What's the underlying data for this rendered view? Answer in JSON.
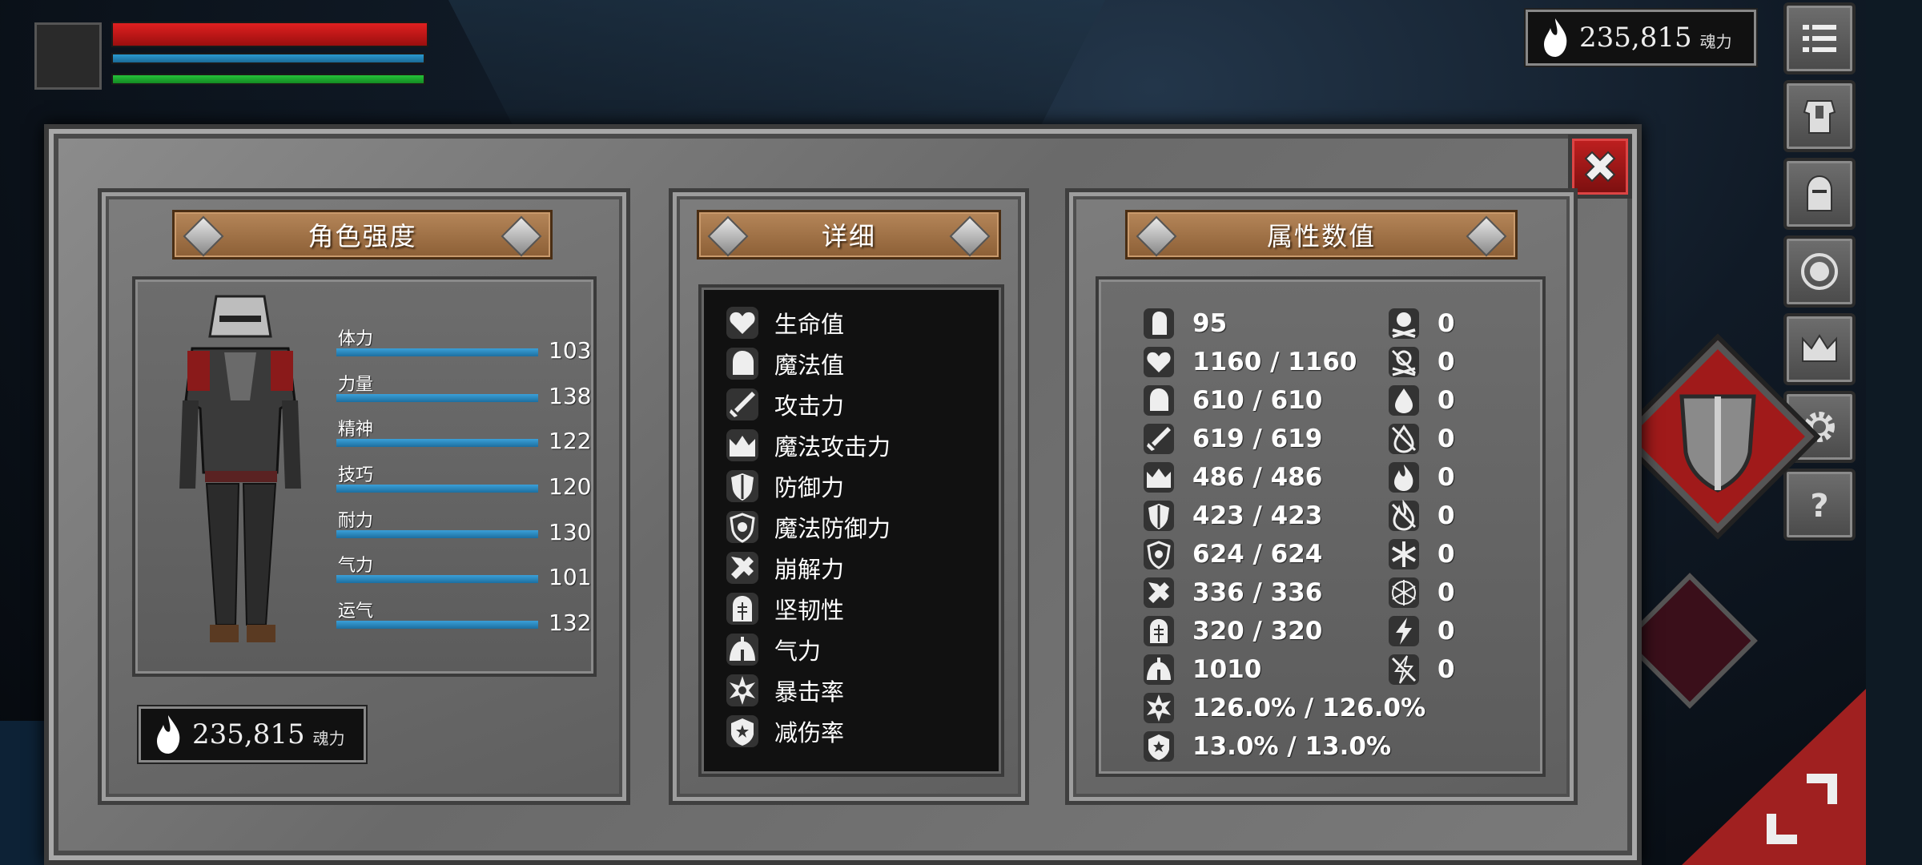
{
  "hud": {
    "hp_fill": 1.0,
    "mp_fill": 1.0,
    "stamina_fill": 1.0
  },
  "souls": {
    "amount": "235,815",
    "unit": "魂力"
  },
  "panels": {
    "left_title": "角色强度",
    "mid_title": "详细",
    "right_title": "属性数值"
  },
  "character_stats": [
    {
      "label": "体力",
      "value": "103"
    },
    {
      "label": "力量",
      "value": "138"
    },
    {
      "label": "精神",
      "value": "122"
    },
    {
      "label": "技巧",
      "value": "120"
    },
    {
      "label": "耐力",
      "value": "130"
    },
    {
      "label": "气力",
      "value": "101"
    },
    {
      "label": "运气",
      "value": "132"
    }
  ],
  "details": [
    {
      "icon": "heart-icon",
      "label": "生命值"
    },
    {
      "icon": "head-icon",
      "label": "魔法值"
    },
    {
      "icon": "sword-icon",
      "label": "攻击力"
    },
    {
      "icon": "magic-attack-icon",
      "label": "魔法攻击力"
    },
    {
      "icon": "shield-icon",
      "label": "防御力"
    },
    {
      "icon": "magic-shield-icon",
      "label": "魔法防御力"
    },
    {
      "icon": "break-icon",
      "label": "崩解力"
    },
    {
      "icon": "helmet-icon",
      "label": "坚韧性"
    },
    {
      "icon": "lungs-icon",
      "label": "气力"
    },
    {
      "icon": "critical-icon",
      "label": "暴击率"
    },
    {
      "icon": "damage-reduction-icon",
      "label": "减伤率"
    }
  ],
  "attributes_left": [
    {
      "icon": "armor-icon",
      "value": "95"
    },
    {
      "icon": "heart-icon",
      "value": "1160 / 1160"
    },
    {
      "icon": "head-icon",
      "value": "610 / 610"
    },
    {
      "icon": "sword-icon",
      "value": "619 / 619"
    },
    {
      "icon": "magic-attack-icon",
      "value": "486 / 486"
    },
    {
      "icon": "shield-icon",
      "value": "423 / 423"
    },
    {
      "icon": "magic-shield-icon",
      "value": "624 / 624"
    },
    {
      "icon": "break-icon",
      "value": "336 / 336"
    },
    {
      "icon": "helmet-icon",
      "value": "320 / 320"
    },
    {
      "icon": "lungs-icon",
      "value": "1010"
    },
    {
      "icon": "critical-icon",
      "value": "126.0% / 126.0%"
    },
    {
      "icon": "damage-reduction-icon",
      "value": "13.0% / 13.0%"
    }
  ],
  "attributes_right": [
    {
      "icon": "poison-skull-icon",
      "value": "0"
    },
    {
      "icon": "poison-resist-icon",
      "value": "0"
    },
    {
      "icon": "bleed-icon",
      "value": "0"
    },
    {
      "icon": "bleed-resist-icon",
      "value": "0"
    },
    {
      "icon": "fire-icon",
      "value": "0"
    },
    {
      "icon": "fire-resist-icon",
      "value": "0"
    },
    {
      "icon": "frost-icon",
      "value": "0"
    },
    {
      "icon": "frost-resist-icon",
      "value": "0"
    },
    {
      "icon": "lightning-icon",
      "value": "0"
    },
    {
      "icon": "lightning-resist-icon",
      "value": "0"
    }
  ],
  "side_menu": [
    "menu-icon",
    "armor-icon",
    "helmet-icon",
    "emblem-icon",
    "crown-icon",
    "gear-icon",
    "help-icon"
  ],
  "colors": {
    "hp": "#e02020",
    "mp": "#2a9ad0",
    "stamina": "#25c23a",
    "stat_bar": "#3aa0d8",
    "close": "#c02020",
    "plank": "#b58659"
  }
}
